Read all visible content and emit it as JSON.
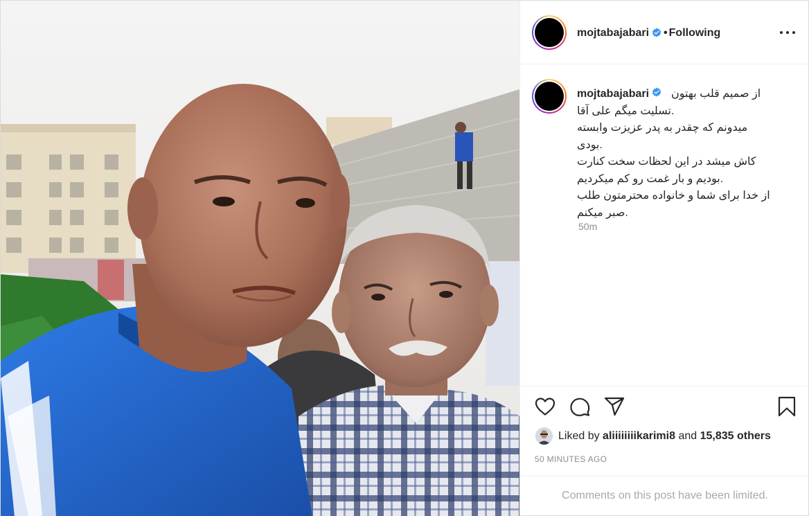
{
  "post": {
    "author": "mojtabajabari",
    "follow_state": "Following",
    "separator": "•",
    "verified": true,
    "caption": {
      "username": "mojtabajabari",
      "lines": [
        "از صمیم قلب بهتون",
        "تسلیت میگم علی آقا.",
        "میدونم که چقدر به پدر عزیزت وابسته",
        "بودی.",
        "کاش میشد در این لحظات سخت کنارت",
        "بودیم و بار غمت رو کم میکردیم.",
        "از خدا برای شما و خانواده محترمتون طلب",
        "صبر میکنم."
      ]
    },
    "timestamp": "50m",
    "likes": {
      "prefix": "Liked by",
      "user": "aliiiiiiiikarimi8",
      "connector": "and",
      "others": "15,835 others"
    },
    "time_ago": "50 MINUTES AGO",
    "comments_notice": "Comments on this post have been limited."
  },
  "icons": {
    "verified": "verified-badge-icon",
    "more": "more-options-icon",
    "like": "heart-icon",
    "comment": "comment-icon",
    "share": "share-icon",
    "save": "bookmark-icon"
  },
  "colors": {
    "verified": "#3897f0",
    "muted": "#8e8e8e",
    "text": "#262626",
    "jersey_blue": "#1f62c9"
  }
}
